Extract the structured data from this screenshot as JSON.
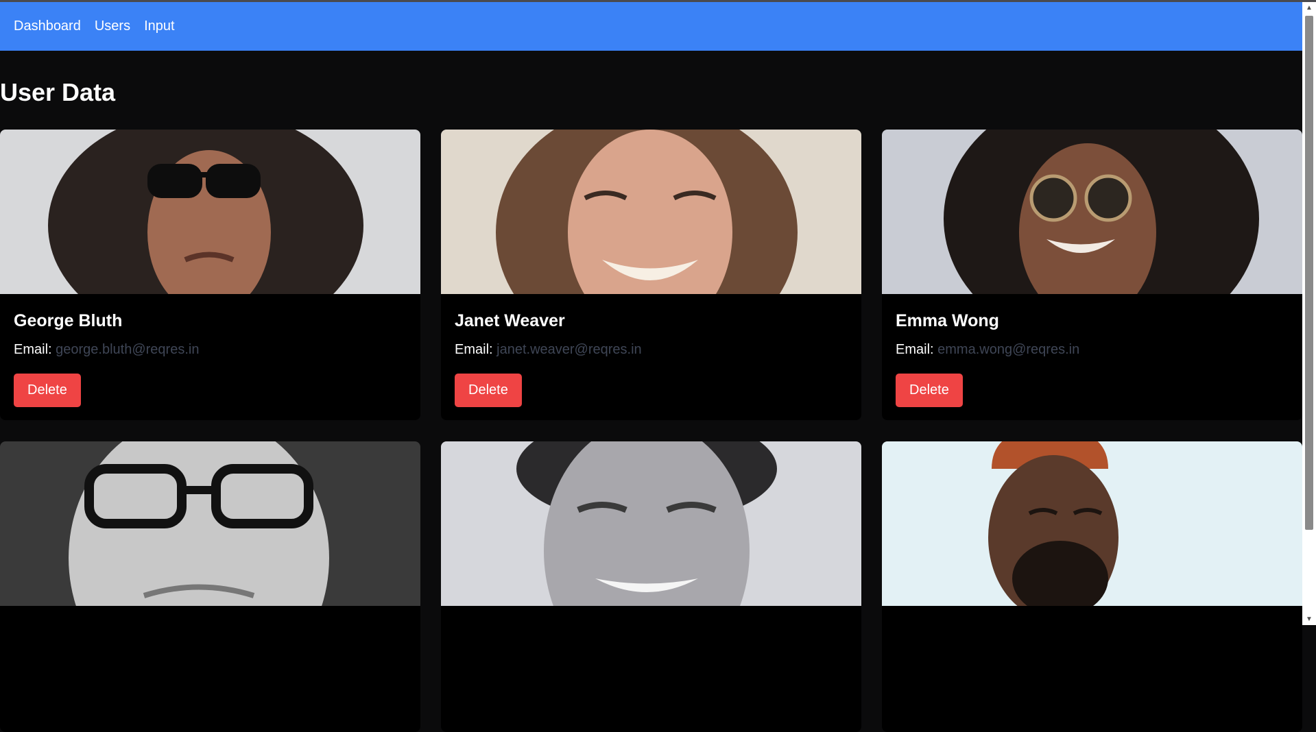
{
  "nav": {
    "links": [
      "Dashboard",
      "Users",
      "Input"
    ]
  },
  "page": {
    "title": "User Data"
  },
  "users": [
    {
      "name": "George Bluth",
      "email_label": "Email:",
      "email": "george.bluth@reqres.in",
      "delete_label": "Delete"
    },
    {
      "name": "Janet Weaver",
      "email_label": "Email:",
      "email": "janet.weaver@reqres.in",
      "delete_label": "Delete"
    },
    {
      "name": "Emma Wong",
      "email_label": "Email:",
      "email": "emma.wong@reqres.in",
      "delete_label": "Delete"
    },
    {
      "name": "",
      "email_label": "",
      "email": "",
      "delete_label": ""
    },
    {
      "name": "",
      "email_label": "",
      "email": "",
      "delete_label": ""
    },
    {
      "name": "",
      "email_label": "",
      "email": "",
      "delete_label": ""
    }
  ],
  "colors": {
    "navbar": "#3b82f6",
    "background": "#0b0b0c",
    "card": "#000000",
    "delete": "#ef4444",
    "email_text": "#3f4656"
  },
  "icons": {
    "scroll_up": "chevron-up-icon",
    "scroll_down": "chevron-down-icon"
  }
}
